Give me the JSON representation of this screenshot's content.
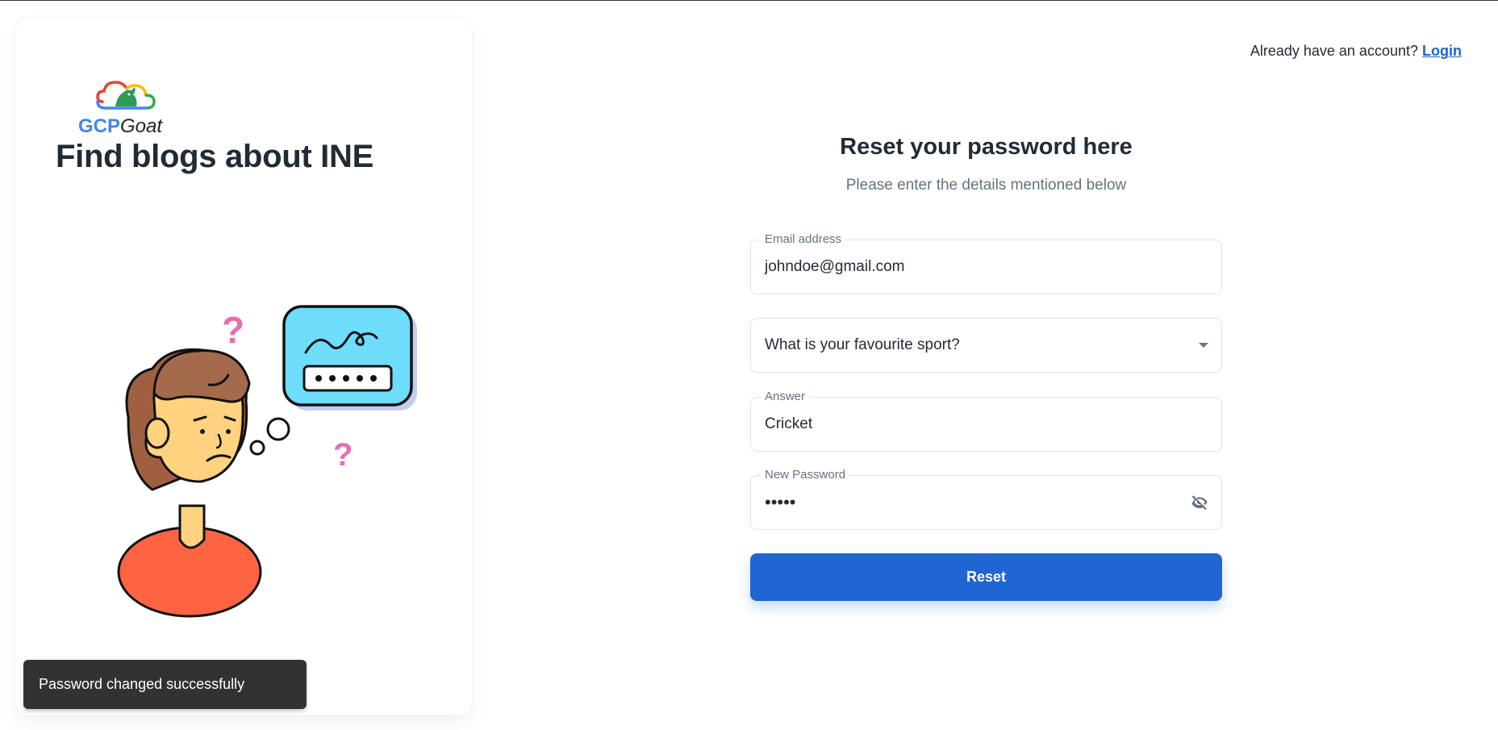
{
  "brand": {
    "logo_text_primary": "GCP",
    "logo_text_secondary": "Goat"
  },
  "hero": {
    "title": "Find blogs about INE"
  },
  "toast": {
    "message": "Password changed successfully"
  },
  "header": {
    "prompt": "Already have an account?",
    "login_label": "Login"
  },
  "form": {
    "title": "Reset your password here",
    "subtitle": "Please enter the details mentioned below",
    "email": {
      "label": "Email address",
      "value": "johndoe@gmail.com"
    },
    "security_question": {
      "value": "What is your favourite sport?"
    },
    "answer": {
      "label": "Answer",
      "value": "Cricket"
    },
    "new_password": {
      "label": "New Password",
      "masked_value": "•••••"
    },
    "submit_label": "Reset"
  },
  "colors": {
    "primary": "#2065d1",
    "text": "#212b36",
    "muted": "#637381",
    "toast_bg": "#323232"
  },
  "icons": {
    "password_toggle": "eye-off-icon",
    "select_caret": "caret-down-icon"
  }
}
